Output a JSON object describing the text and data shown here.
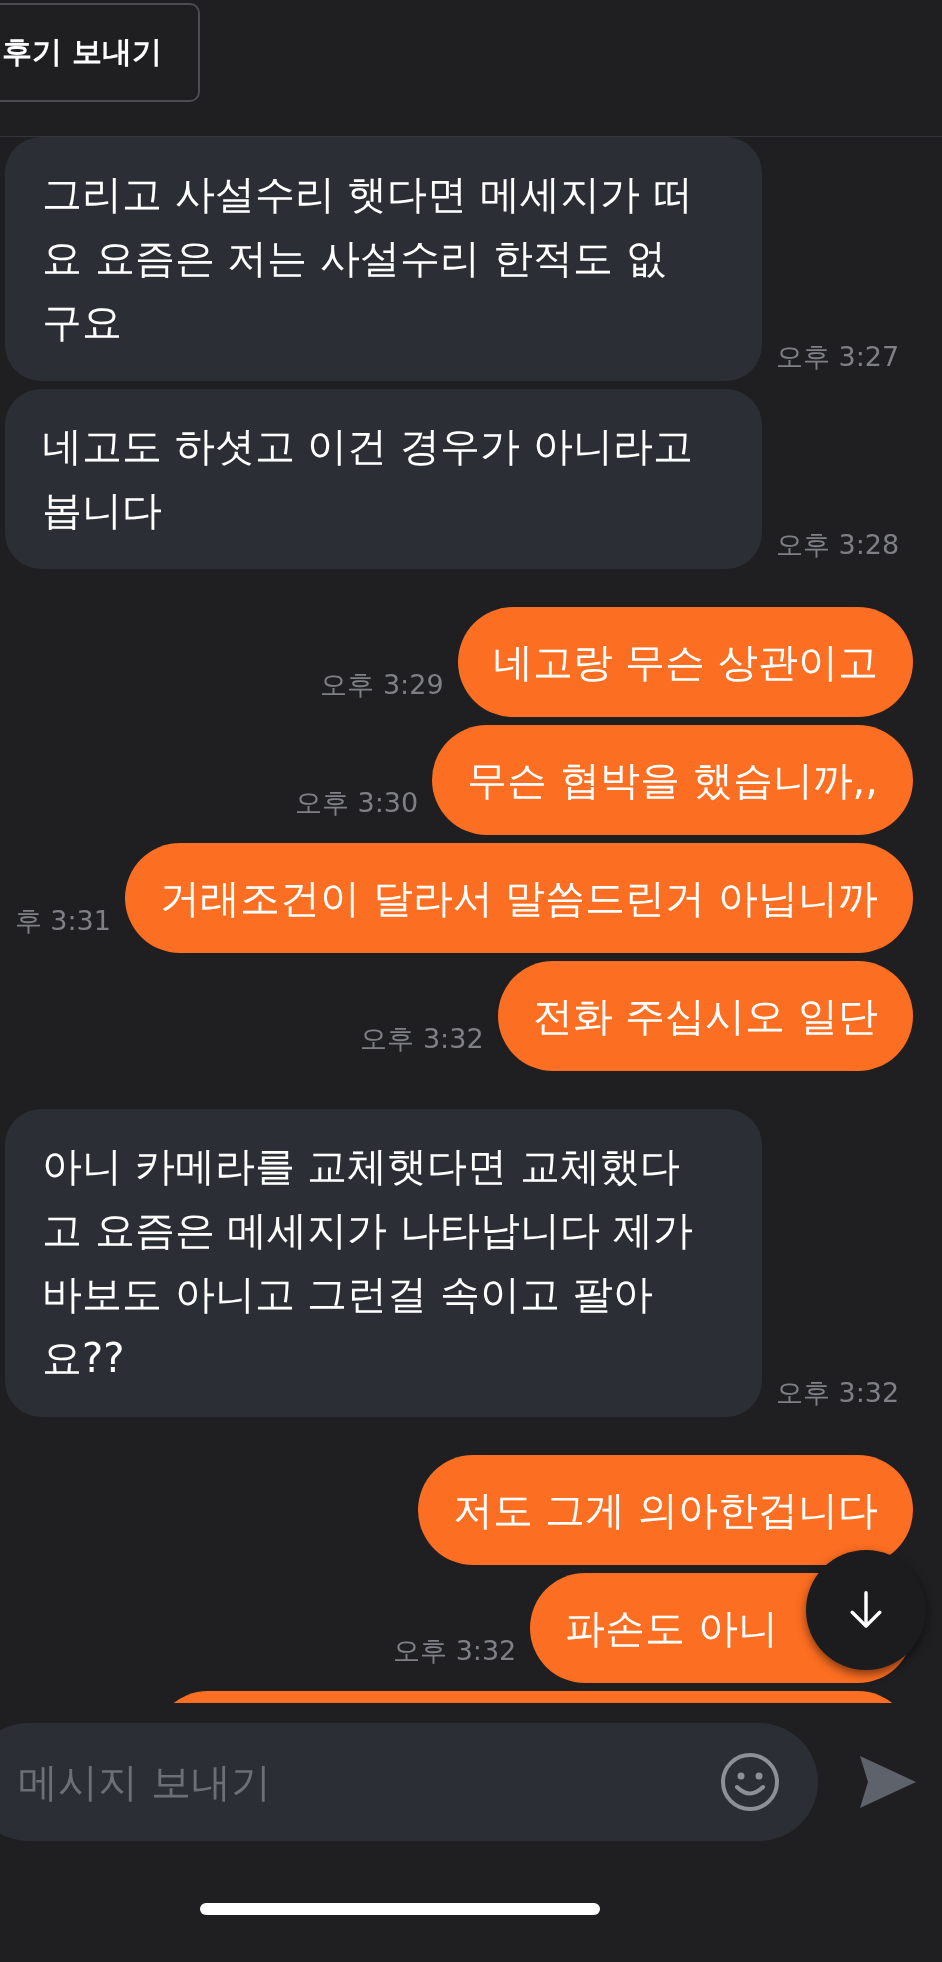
{
  "header": {
    "button": "후기 보내기"
  },
  "messages": [
    {
      "outgoing": false,
      "text": "그리고 사설수리 햇다면 메세지가 떠요 요즘은 저는 사설수리 한적도 없구요",
      "time": "오후 3:27"
    },
    {
      "outgoing": false,
      "text": "네고도 하셧고 이건 경우가 아니라고 봅니다",
      "time": "오후 3:28"
    },
    {
      "outgoing": true,
      "text": "네고랑 무슨 상관이고",
      "time": "오후 3:29"
    },
    {
      "outgoing": true,
      "text": "무슨 협박을 했습니까,,",
      "time": "오후 3:30"
    },
    {
      "outgoing": true,
      "text": "거래조건이 달라서 말씀드린거 아닙니까",
      "time": "후 3:31"
    },
    {
      "outgoing": true,
      "text": "전화 주십시오 일단",
      "time": "오후 3:32"
    },
    {
      "outgoing": false,
      "text": "아니 카메라를 교체햇다면 교체했다고 요즘은 메세지가 나타납니다 제가 바보도 아니고 그런걸 속이고 팔아요??",
      "time": "오후 3:32"
    },
    {
      "outgoing": true,
      "text": "저도 그게 의아한겁니다"
    },
    {
      "outgoing": true,
      "text": "파손도 아니",
      "time": "오후 3:32",
      "under_button": true
    },
    {
      "outgoing": true,
      "clipped": true
    }
  ],
  "composer": {
    "placeholder": "메시지 보내기"
  }
}
